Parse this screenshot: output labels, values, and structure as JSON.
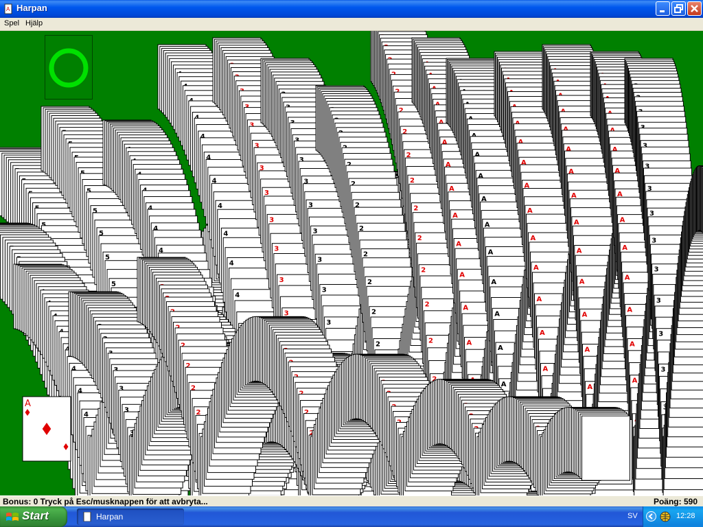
{
  "window": {
    "title": "Harpan"
  },
  "menu": {
    "game": "Spel",
    "help": "Hjälp"
  },
  "status": {
    "message": "Bonus: 0  Tryck på Esc/musknappen för att avbryta...",
    "score": "Poäng: 590"
  },
  "taskbar": {
    "start_label": "Start",
    "task_label": "Harpan",
    "language": "SV",
    "clock": "12:28"
  },
  "colors": {
    "felt": "#008000",
    "titlebar_blue": "#0058EE",
    "card_red": "#E00000",
    "card_black": "#000000",
    "foundation_ring": "#00E000"
  },
  "cards": {
    "visible_ranks": [
      "A",
      "2",
      "3",
      "4",
      "5"
    ],
    "visible_suits": [
      "spades",
      "diamonds",
      "hearts"
    ],
    "front_card": {
      "rank": "A",
      "suit": "diamonds"
    }
  },
  "icons": [
    "app-icon",
    "minimize-icon",
    "maximize-icon",
    "close-icon",
    "windows-logo-icon",
    "tray-arrow-icon",
    "globe-icon"
  ]
}
